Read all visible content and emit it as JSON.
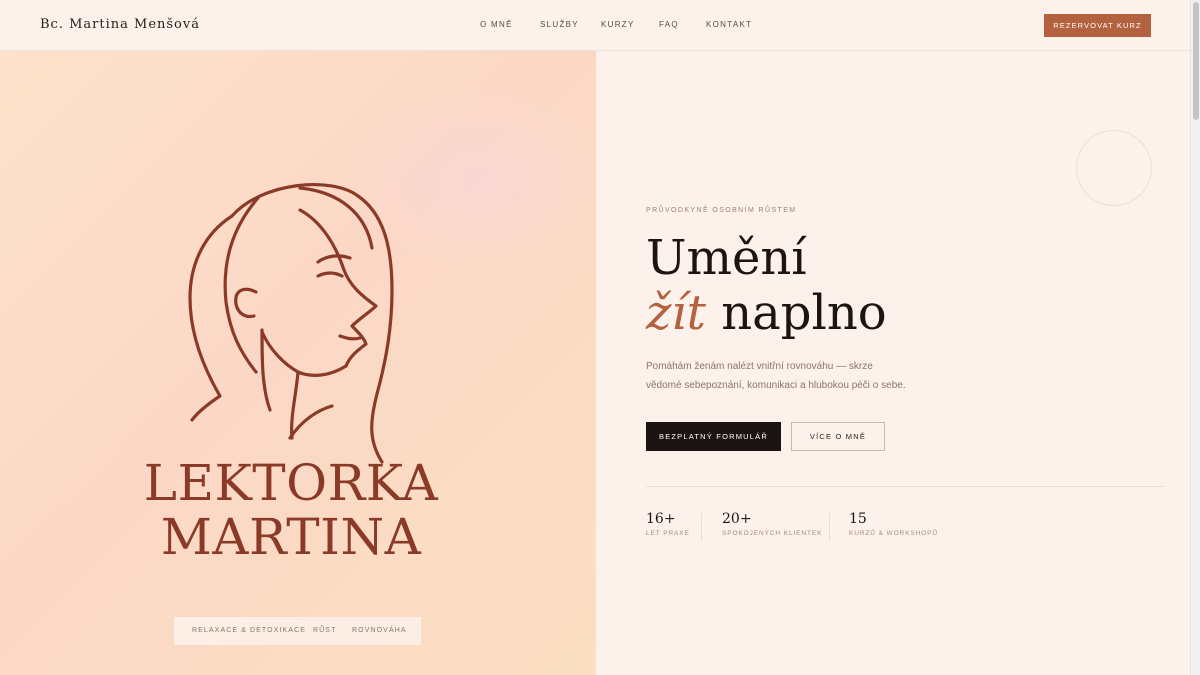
{
  "header": {
    "brand": "Bc. Martina Menšová",
    "nav": [
      {
        "label": "O MNĚ"
      },
      {
        "label": "SLUŽBY"
      },
      {
        "label": "KURZY"
      },
      {
        "label": "FAQ"
      },
      {
        "label": "KONTAKT"
      }
    ],
    "cta_label": "REZERVOVAT KURZ"
  },
  "hero_left": {
    "logo_line_1": "LEKTORKA",
    "logo_line_2": "MARTINA",
    "tags": [
      "RELAXACE & DETOXIKACE",
      "RŮST",
      "ROVNOVÁHA"
    ]
  },
  "hero_right": {
    "eyebrow": "PRŮVODKYNĚ OSOBNÍM RŮSTEM",
    "headline_line_1": "Umění",
    "headline_accent": "žít",
    "headline_rest": "naplno",
    "lede": "Pomáhám ženám nalézt vnitřní rovnováhu — skrze vědomé sebepoznání, komunikaci a hlubokou péči o sebe.",
    "primary_button": "BEZPLATNÝ FORMULÁŘ",
    "secondary_button": "VÍCE O MNĚ",
    "stats": [
      {
        "value": "16+",
        "label": "LET PRAXE"
      },
      {
        "value": "20+",
        "label": "SPOKOJENÝCH KLIENTEK"
      },
      {
        "value": "15",
        "label": "KURZŮ & WORKSHOPŮ"
      }
    ]
  },
  "colors": {
    "accent": "#b4613f",
    "logo_brown": "#8b3a28",
    "dark": "#1c1412",
    "background": "#fdf1eb"
  },
  "icons": {
    "portrait": "woman-profile-line-art"
  }
}
